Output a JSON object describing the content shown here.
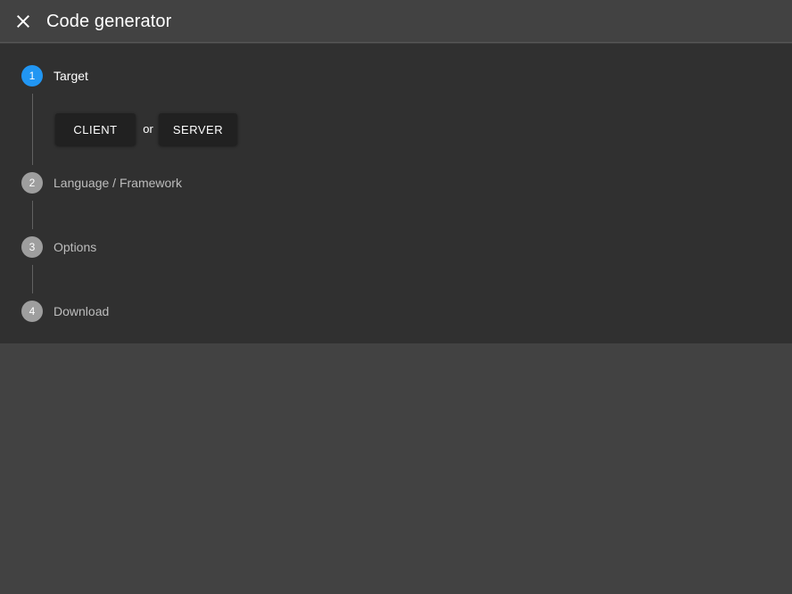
{
  "toolbar": {
    "close_icon": "close-icon",
    "title": "Code generator"
  },
  "stepper": {
    "steps": [
      {
        "number": "1",
        "label": "Target",
        "state": "active"
      },
      {
        "number": "2",
        "label": "Language / Framework",
        "state": "inactive"
      },
      {
        "number": "3",
        "label": "Options",
        "state": "inactive"
      },
      {
        "number": "4",
        "label": "Download",
        "state": "inactive"
      }
    ],
    "target": {
      "client_label": "CLIENT",
      "or_label": "or",
      "server_label": "SERVER"
    }
  },
  "colors": {
    "active_step": "#2196f3",
    "inactive_step": "#9e9e9e",
    "panel_bg": "#303030",
    "app_bg": "#424242"
  }
}
